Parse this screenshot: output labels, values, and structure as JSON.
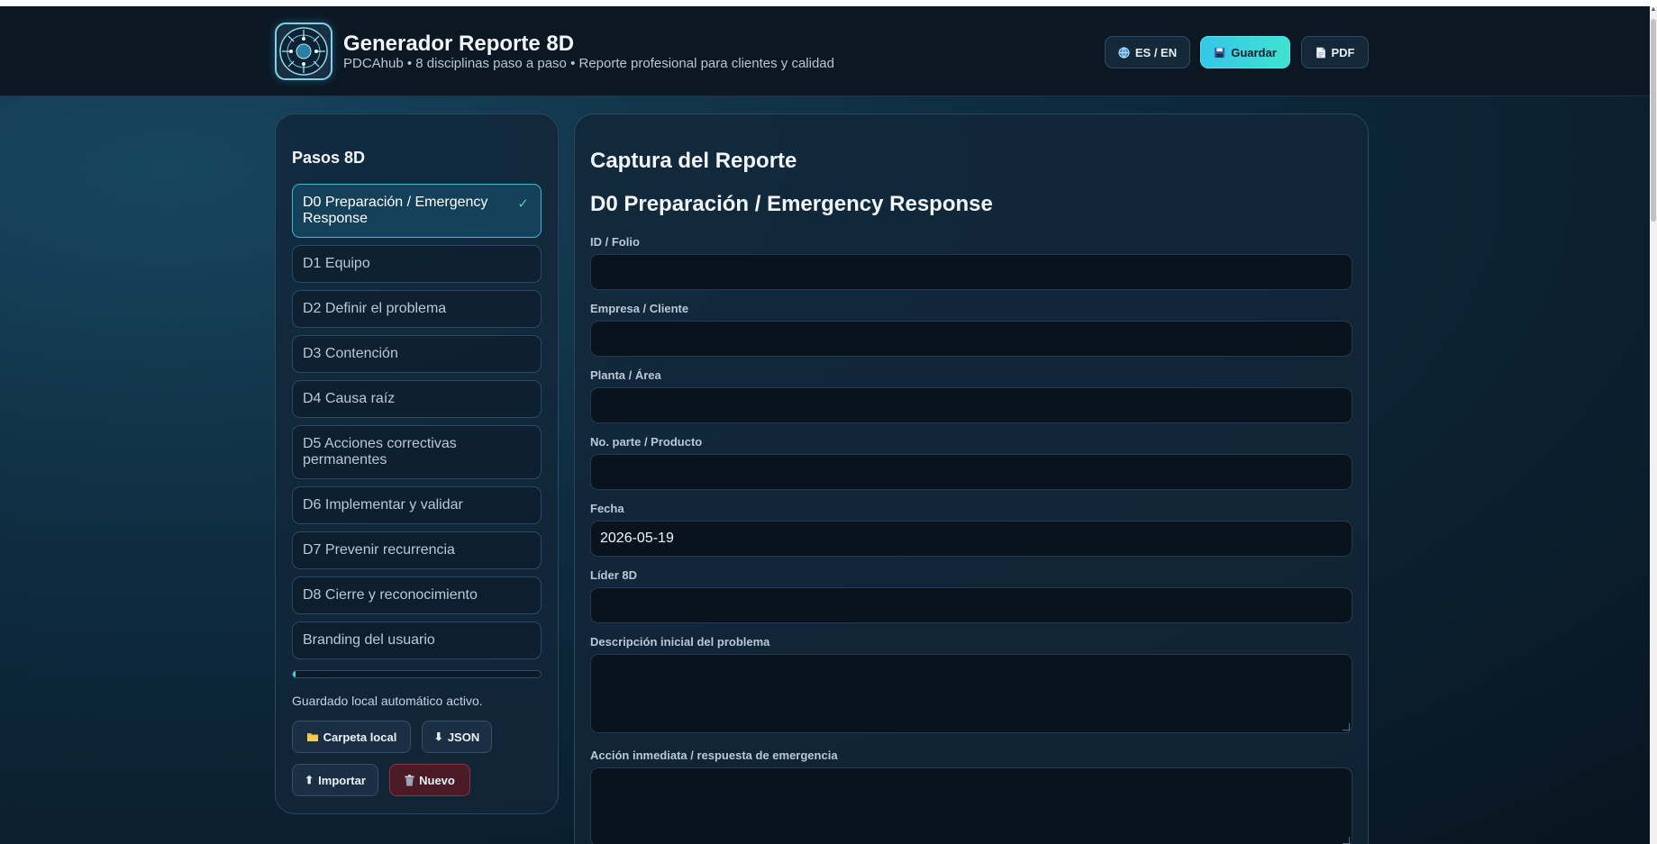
{
  "header": {
    "title": "Generador Reporte 8D",
    "subtitle": "PDCAhub • 8 disciplinas paso a paso • Reporte profesional para clientes y calidad",
    "lang_label": "ES / EN",
    "save_label": "Guardar",
    "pdf_label": "PDF",
    "logo_icon": "pdcahub-logo-icon"
  },
  "sidebar": {
    "title": "Pasos 8D",
    "steps": [
      {
        "label": "D0 Preparación / Emergency Response",
        "active": true,
        "done": true
      },
      {
        "label": "D1 Equipo"
      },
      {
        "label": "D2 Definir el problema"
      },
      {
        "label": "D3 Contención"
      },
      {
        "label": "D4 Causa raíz"
      },
      {
        "label": "D5 Acciones correctivas permanentes"
      },
      {
        "label": "D6 Implementar y validar"
      },
      {
        "label": "D7 Prevenir recurrencia"
      },
      {
        "label": "D8 Cierre y reconocimiento"
      },
      {
        "label": "Branding del usuario"
      }
    ],
    "check_glyph": "✓",
    "progress_percent": 1,
    "autosave_text": "Guardado local automático activo.",
    "buttons": {
      "local_folder": "Carpeta local",
      "json": "JSON",
      "import": "Importar",
      "new": "Nuevo"
    }
  },
  "main": {
    "title": "Captura del Reporte",
    "section_title": "D0 Preparación / Emergency Response",
    "fields": [
      {
        "label": "ID / Folio",
        "value": ""
      },
      {
        "label": "Empresa / Cliente",
        "value": ""
      },
      {
        "label": "Planta / Área",
        "value": ""
      },
      {
        "label": "No. parte / Producto",
        "value": ""
      },
      {
        "label": "Fecha",
        "value": "2026-05-19"
      },
      {
        "label": "Líder 8D",
        "value": ""
      },
      {
        "label": "Descripción inicial del problema",
        "value": ""
      },
      {
        "label": "Acción inmediata / respuesta de emergencia",
        "value": ""
      }
    ]
  },
  "colors": {
    "accent": "#35c6e9",
    "accent2": "#3fe3cf",
    "danger": "#8a3344",
    "check": "#49d89c"
  }
}
